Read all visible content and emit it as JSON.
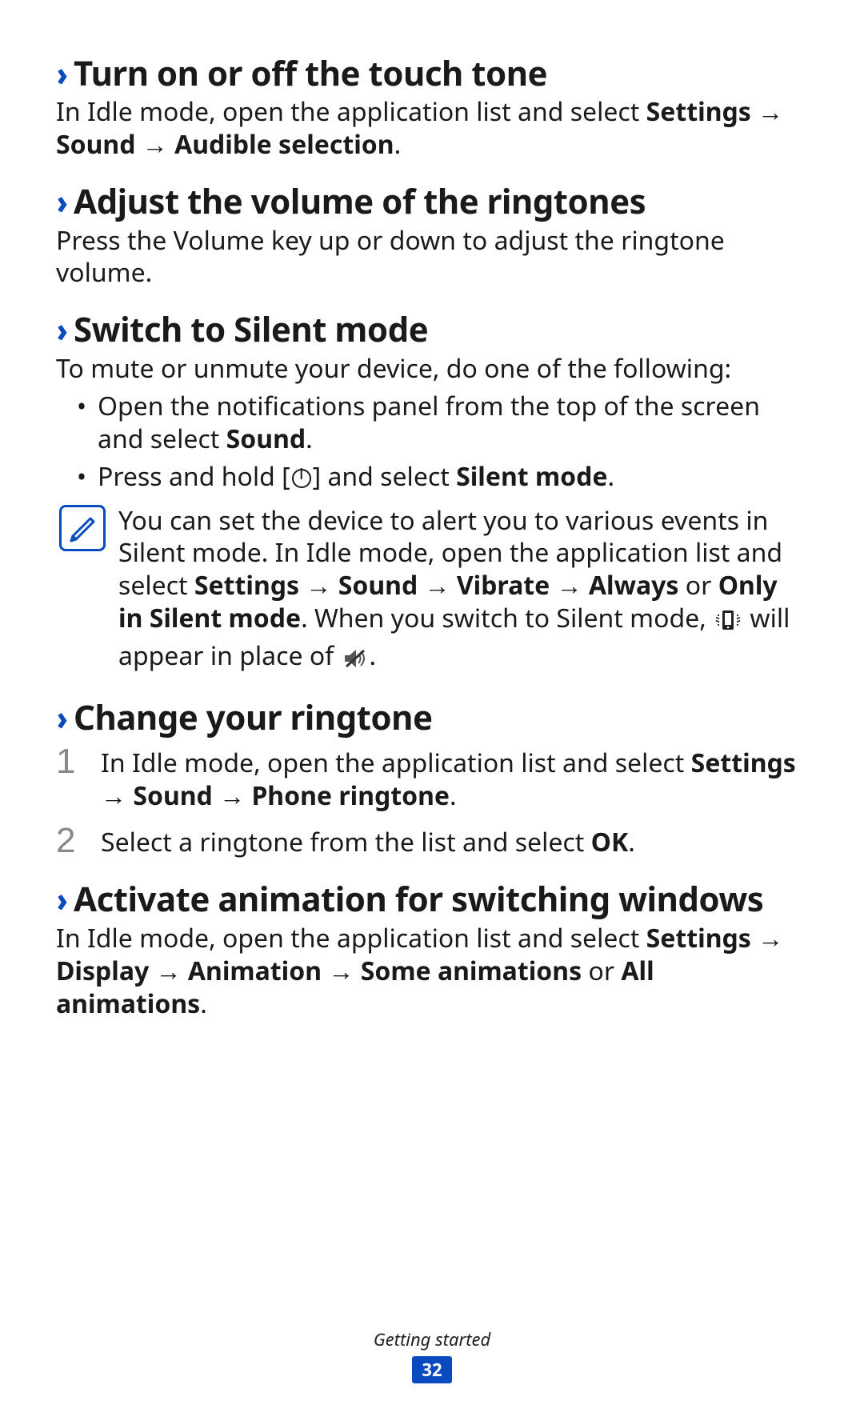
{
  "sections": {
    "touch_tone": {
      "heading": "Turn on or off the touch tone",
      "p1_a": "In Idle mode, open the application list and select ",
      "p1_b": "Settings",
      "arrow": " → ",
      "p1_c": "Sound",
      "p1_d": "Audible selection",
      "period": "."
    },
    "volume": {
      "heading": "Adjust the volume of the ringtones",
      "p1": "Press the Volume key up or down to adjust the ringtone volume."
    },
    "silent": {
      "heading": "Switch to Silent mode",
      "p1": "To mute or unmute your device, do one of the following:",
      "li1_a": "Open the notifications panel from the top of the screen and select ",
      "li1_b": "Sound",
      "li1_c": ".",
      "li2_a": "Press and hold [",
      "li2_b": "] and select ",
      "li2_c": "Silent mode",
      "li2_d": ".",
      "note_a": "You can set the device to alert you to various events in Silent mode. In Idle mode, open the application list and select ",
      "note_b": "Settings",
      "note_c": "Sound",
      "note_d": "Vibrate",
      "note_e": "Always",
      "note_or": " or ",
      "note_f": "Only in Silent mode",
      "note_g": ". When you switch to Silent mode, ",
      "note_h": " will appear in place of ",
      "note_i": "."
    },
    "ringtone": {
      "heading": "Change your ringtone",
      "step1_num": "1",
      "step1_a": "In Idle mode, open the application list and select ",
      "step1_b": "Settings",
      "step1_c": "Sound",
      "step1_d": "Phone ringtone",
      "step1_e": ".",
      "step2_num": "2",
      "step2_a": "Select a ringtone from the list and select ",
      "step2_b": "OK",
      "step2_c": "."
    },
    "animation": {
      "heading": "Activate animation for switching windows",
      "p1_a": "In Idle mode, open the application list and select ",
      "p1_b": "Settings",
      "p1_c": "Display",
      "p1_d": "Animation",
      "p1_e": "Some animations",
      "p1_or": " or ",
      "p1_f": "All animations",
      "p1_g": "."
    }
  },
  "footer": {
    "label": "Getting started",
    "page": "32"
  }
}
